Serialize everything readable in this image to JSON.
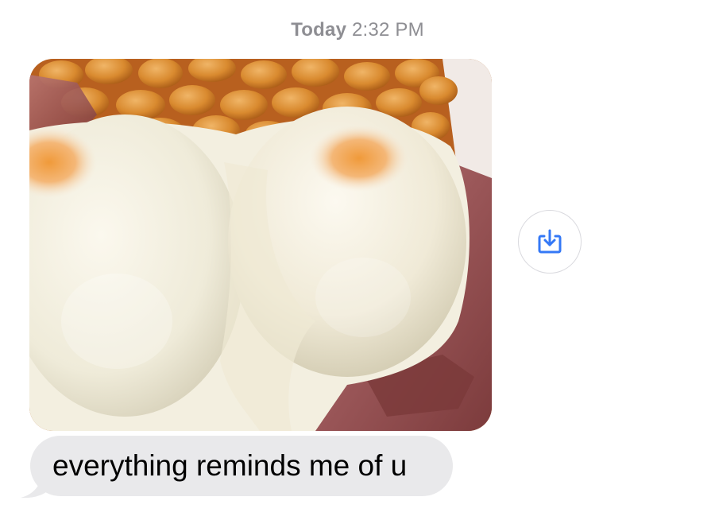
{
  "timestamp": {
    "day": "Today",
    "time": "2:32 PM"
  },
  "messages": [
    {
      "type": "image",
      "direction": "incoming",
      "content_description": "photo of two fried eggs on baked beans with bacon"
    },
    {
      "type": "text",
      "direction": "incoming",
      "text": "everything reminds me of u"
    }
  ],
  "actions": {
    "save_icon": "square-arrow-down-icon"
  },
  "colors": {
    "incoming_bubble": "#e9e9eb",
    "timestamp_text": "#8e8e93",
    "action_accent": "#3478f6",
    "background": "#ffffff"
  }
}
